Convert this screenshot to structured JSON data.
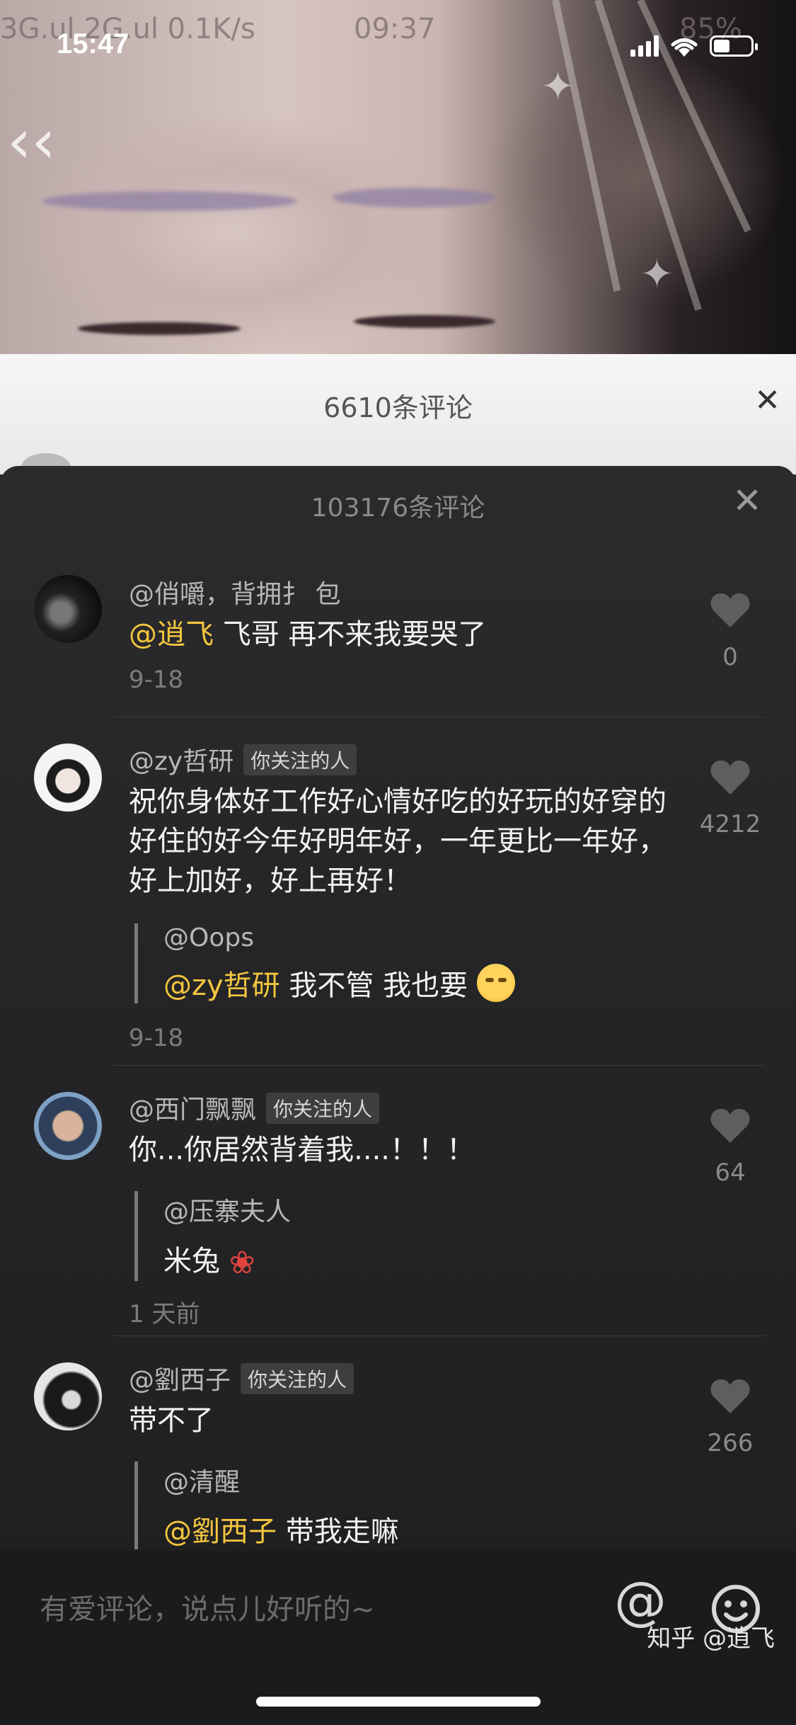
{
  "status_bar": {
    "time": "15:47"
  },
  "background_photo": {
    "ghost_status_left": "3G.ul  2G.ul  0.1K/s",
    "ghost_status_time": "09:37",
    "ghost_status_right": "85%"
  },
  "under_sheet": {
    "title": "6610条评论"
  },
  "sheet": {
    "title": "103176条评论"
  },
  "comments": [
    {
      "user": "@俏嚼，背拥扌 包",
      "tag": "",
      "mention": "@逍飞",
      "text": " 飞哥 再不来我要哭了",
      "date": "9-18",
      "likes": "0"
    },
    {
      "user": "@zy哲研",
      "tag": "你关注的人",
      "text": "祝你身体好工作好心情好吃的好玩的好穿的好住的好今年好明年好，一年更比一年好，好上加好，好上再好！",
      "reply": {
        "user": "@Oops",
        "mention": "@zy哲研",
        "text": " 我不管 我也要"
      },
      "date": "9-18",
      "likes": "4212"
    },
    {
      "user": "@西门飘飘",
      "tag": "你关注的人",
      "text": "你...你居然背着我....！！！",
      "reply": {
        "user": "@压寨夫人",
        "text": "米兔"
      },
      "date": "1 天前",
      "likes": "64"
    },
    {
      "user": "@劉西子",
      "tag": "你关注的人",
      "text": "带不了",
      "reply": {
        "user": "@清醒",
        "mention": "@劉西子",
        "text": " 带我走嘛"
      },
      "likes": "266"
    }
  ],
  "input": {
    "placeholder": "有爱评论，说点儿好听的~"
  },
  "watermark": "知乎 @逍飞",
  "icons": {
    "back": "back-arrow-icon",
    "close": "close-icon",
    "like": "heart-icon",
    "at": "at-icon",
    "emoji": "emoji-icon",
    "signal": "signal-icon",
    "wifi": "wifi-icon",
    "battery": "battery-icon"
  }
}
